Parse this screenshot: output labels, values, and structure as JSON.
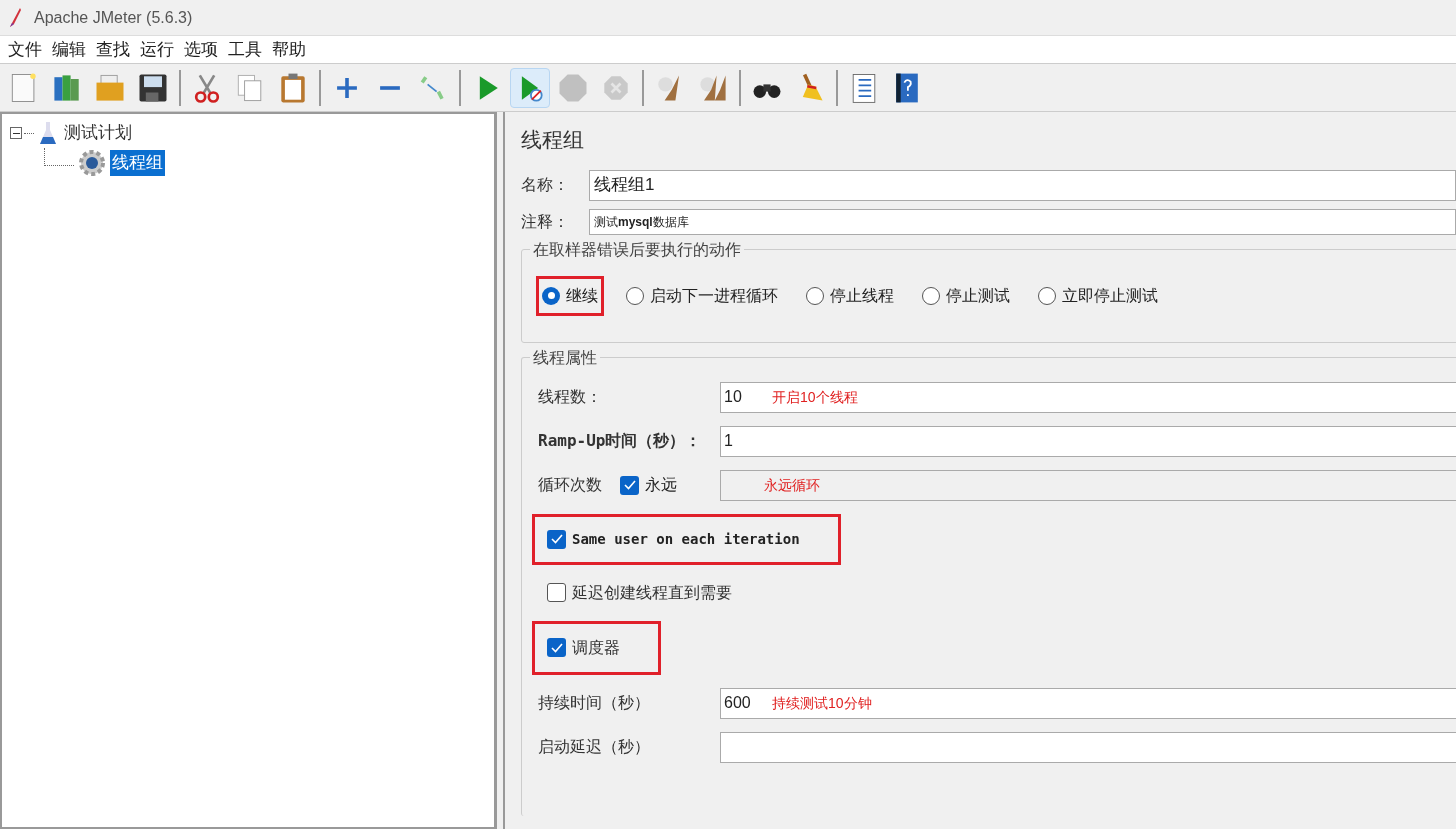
{
  "window": {
    "title": "Apache JMeter (5.6.3)"
  },
  "menu": [
    "文件",
    "编辑",
    "查找",
    "运行",
    "选项",
    "工具",
    "帮助"
  ],
  "toolbar": [
    {
      "kind": "new",
      "disabled": false,
      "hovered": false
    },
    {
      "kind": "templates",
      "disabled": false,
      "hovered": false
    },
    {
      "kind": "open",
      "disabled": false,
      "hovered": false
    },
    {
      "kind": "save",
      "disabled": false,
      "hovered": false
    },
    {
      "kind": "separator"
    },
    {
      "kind": "cut",
      "disabled": false,
      "hovered": false
    },
    {
      "kind": "copy",
      "disabled": false,
      "hovered": false
    },
    {
      "kind": "paste",
      "disabled": false,
      "hovered": false
    },
    {
      "kind": "separator"
    },
    {
      "kind": "expand",
      "disabled": false,
      "hovered": false
    },
    {
      "kind": "collapse",
      "disabled": false,
      "hovered": false
    },
    {
      "kind": "toggle",
      "disabled": false,
      "hovered": false
    },
    {
      "kind": "separator"
    },
    {
      "kind": "start",
      "disabled": false,
      "hovered": false
    },
    {
      "kind": "start_no_timers",
      "disabled": false,
      "hovered": true
    },
    {
      "kind": "stop",
      "disabled": true,
      "hovered": false
    },
    {
      "kind": "shutdown",
      "disabled": true,
      "hovered": false
    },
    {
      "kind": "separator"
    },
    {
      "kind": "clear",
      "disabled": false,
      "hovered": false
    },
    {
      "kind": "clear_all",
      "disabled": false,
      "hovered": false
    },
    {
      "kind": "separator"
    },
    {
      "kind": "search",
      "disabled": false,
      "hovered": false
    },
    {
      "kind": "reset_search",
      "disabled": false,
      "hovered": false
    },
    {
      "kind": "separator"
    },
    {
      "kind": "functions",
      "disabled": false,
      "hovered": false
    },
    {
      "kind": "help",
      "disabled": false,
      "hovered": false
    }
  ],
  "tree": [
    {
      "label": "测试计划",
      "kind": "plan",
      "expanded": true,
      "selected": false,
      "children": [
        {
          "label": "线程组",
          "kind": "thread_group",
          "selected": true
        }
      ]
    }
  ],
  "panel": {
    "title": "线程组",
    "name": {
      "label": "名称：",
      "value": "线程组1"
    },
    "comment": {
      "label": "注释：",
      "value": "测试**mysql**数据库"
    },
    "on_error": {
      "title": "在取样器错误后要执行的动作",
      "options": [
        {
          "label": "继续",
          "selected": true,
          "highlighted": true
        },
        {
          "label": "启动下一进程循环",
          "selected": false,
          "highlighted": false
        },
        {
          "label": "停止线程",
          "selected": false,
          "highlighted": false
        },
        {
          "label": "停止测试",
          "selected": false,
          "highlighted": false
        },
        {
          "label": "立即停止测试",
          "selected": false,
          "highlighted": false
        }
      ]
    },
    "thread_properties": {
      "title": "线程属性",
      "rows": [
        {
          "kind": "field",
          "label": "线程数：",
          "value": "10",
          "note": "开启10个线程"
        },
        {
          "kind": "field",
          "label": "Ramp-Up时间（秒）：",
          "value": "1"
        },
        {
          "kind": "loop",
          "label": "循环次数",
          "checkbox_label": "永远",
          "checked": true,
          "note": "永远循环"
        },
        {
          "kind": "checkbox",
          "label": "Same user on each iteration",
          "checked": true,
          "highlighted": true
        },
        {
          "kind": "checkbox",
          "label": "延迟创建线程直到需要",
          "checked": false,
          "highlighted": false
        },
        {
          "kind": "checkbox",
          "label": "调度器",
          "checked": true,
          "highlighted": true
        },
        {
          "kind": "field",
          "label": "持续时间（秒）",
          "value": "600",
          "note": "持续测试10分钟"
        },
        {
          "kind": "field",
          "label": "启动延迟（秒）"
        }
      ]
    }
  }
}
